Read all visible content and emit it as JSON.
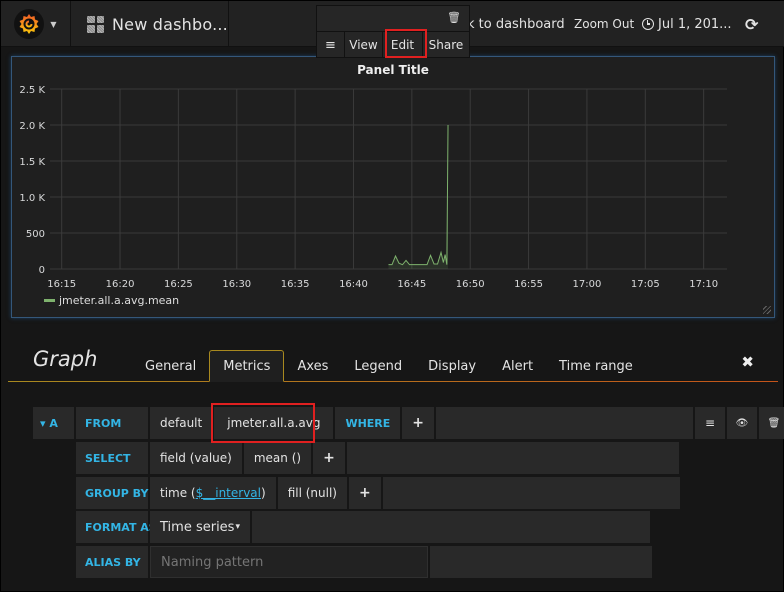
{
  "navbar": {
    "logo_icon": "grafana-logo-icon",
    "dashboard_icon": "dashboard-grid-icon",
    "dashboard_title": "New dashbo...",
    "back_link": "k to dashboard",
    "zoom_out": "Zoom Out",
    "time_range": "Jul 1, 201...",
    "clock_icon": "clock-icon",
    "refresh_icon": "refresh-icon",
    "refresh_glyph": "⟳"
  },
  "panel_menu": {
    "trash_glyph": "🗑",
    "menu_glyph": "≡",
    "view": "View",
    "edit": "Edit",
    "share": "Share",
    "highlight_color": "#e02020"
  },
  "panel": {
    "title": "Panel Title",
    "legend_label": "jmeter.all.a.avg.mean",
    "series_color": "#7eb26d"
  },
  "chart_data": {
    "type": "line",
    "title": "Panel Title",
    "xlabel": "",
    "ylabel": "",
    "y_ticks": [
      "0",
      "500",
      "1.0 K",
      "1.5 K",
      "2.0 K",
      "2.5 K"
    ],
    "y_tick_values": [
      0,
      500,
      1000,
      1500,
      2000,
      2500
    ],
    "ylim": [
      0,
      2500
    ],
    "x_ticks": [
      "16:15",
      "16:20",
      "16:25",
      "16:30",
      "16:35",
      "16:40",
      "16:45",
      "16:50",
      "16:55",
      "17:00",
      "17:05",
      "17:10"
    ],
    "x_tick_minutes": [
      975,
      980,
      985,
      990,
      995,
      1000,
      1005,
      1010,
      1015,
      1020,
      1025,
      1030
    ],
    "xlim_minutes": [
      974,
      1032
    ],
    "grid": true,
    "legend": "bottom-left",
    "series": [
      {
        "name": "jmeter.all.a.avg.mean",
        "color": "#7eb26d",
        "x_minutes": [
          1003.0,
          1003.3,
          1003.6,
          1003.9,
          1004.2,
          1004.5,
          1004.8,
          1005.1,
          1005.4,
          1005.7,
          1006.0,
          1006.3,
          1006.6,
          1006.9,
          1007.2,
          1007.5,
          1007.7,
          1007.85,
          1008.0,
          1008.1
        ],
        "values": [
          60,
          60,
          180,
          80,
          60,
          120,
          60,
          60,
          60,
          60,
          60,
          60,
          190,
          70,
          70,
          230,
          90,
          200,
          60,
          2000
        ]
      }
    ]
  },
  "editor": {
    "title": "Graph",
    "tabs": [
      "General",
      "Metrics",
      "Axes",
      "Legend",
      "Display",
      "Alert",
      "Time range"
    ],
    "active_tab": "Metrics",
    "close_glyph": "✖",
    "query": {
      "ref_id": "▾ A",
      "from_label": "FROM",
      "from_policy": "default",
      "from_measurement": "jmeter.all.a.avg",
      "where_label": "WHERE",
      "plus": "+",
      "select_label": "SELECT",
      "select_field": "field (value)",
      "select_fn": "mean ()",
      "group_label": "GROUP BY",
      "group_time_prefix": "time (",
      "group_time_var": "$__interval",
      "group_time_suffix": ")",
      "group_fill": "fill (null)",
      "format_label": "FORMAT AS",
      "format_value": "Time series",
      "format_caret": "▾",
      "alias_label": "ALIAS BY",
      "alias_placeholder": "Naming pattern",
      "alias_value": "",
      "menu_glyph": "≡",
      "eye_glyph": "👁",
      "trash_glyph": "🗑"
    }
  }
}
